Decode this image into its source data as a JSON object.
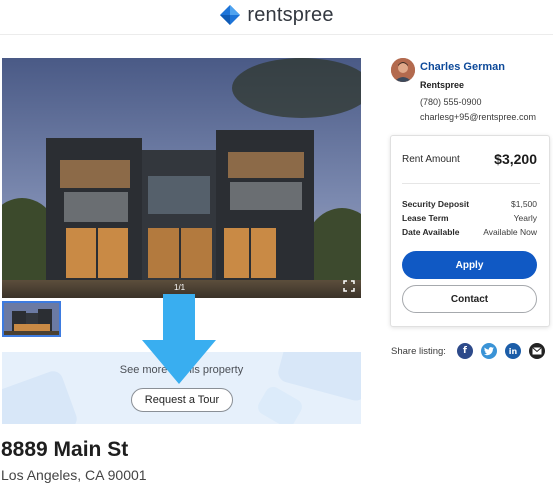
{
  "header": {
    "brand_name": "rentspree",
    "brand_color": "#1d74d8"
  },
  "photo": {
    "counter": "1/1",
    "fullscreen_icon": "expand-icon"
  },
  "tour_banner": {
    "text": "See more of this property",
    "button_label": "Request a Tour",
    "arrow_color": "#39aef0"
  },
  "listing": {
    "address": "8889 Main St",
    "city_state_zip": "Los Angeles, CA 90001"
  },
  "agent": {
    "name": "Charles German",
    "company": "Rentspree",
    "phone": "(780) 555-0900",
    "email": "charlesg+95@rentspree.com"
  },
  "pricing": {
    "rent_label": "Rent Amount",
    "rent_value": "$3,200",
    "details": [
      {
        "label": "Security Deposit",
        "value": "$1,500"
      },
      {
        "label": "Lease Term",
        "value": "Yearly"
      },
      {
        "label": "Date Available",
        "value": "Available Now"
      }
    ],
    "apply_label": "Apply",
    "contact_label": "Contact",
    "accent_color": "#1059c4"
  },
  "share": {
    "label": "Share listing:",
    "icons": [
      "facebook-icon",
      "twitter-icon",
      "linkedin-icon",
      "email-icon"
    ]
  }
}
